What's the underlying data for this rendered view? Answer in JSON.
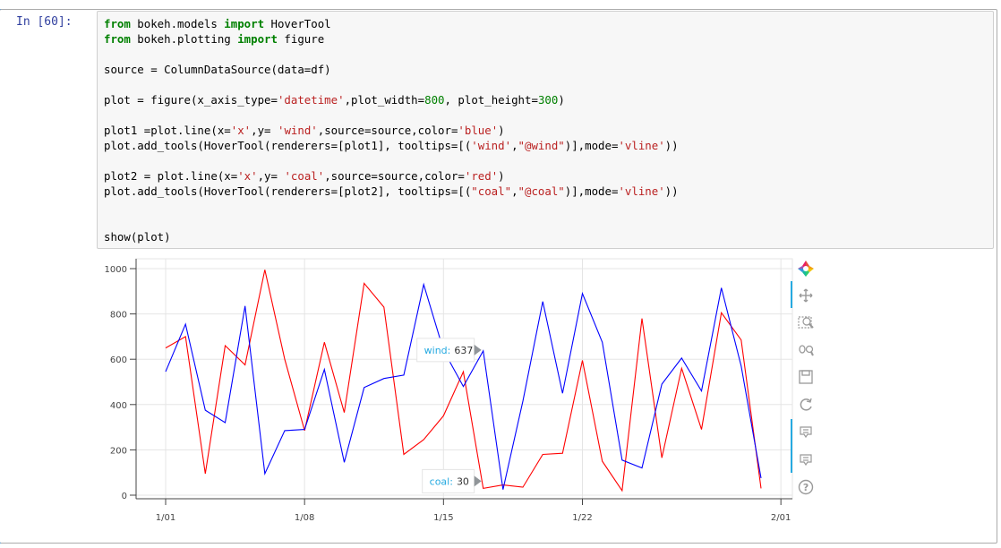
{
  "cell": {
    "prompt": "In [60]:",
    "code_lines": [
      [
        {
          "t": "from",
          "c": "kw"
        },
        {
          "t": " bokeh.models "
        },
        {
          "t": "import",
          "c": "kw"
        },
        {
          "t": " HoverTool"
        }
      ],
      [
        {
          "t": "from",
          "c": "kw"
        },
        {
          "t": " bokeh.plotting "
        },
        {
          "t": "import",
          "c": "kw"
        },
        {
          "t": " figure"
        }
      ],
      [],
      [
        {
          "t": "source = ColumnDataSource(data=df)"
        }
      ],
      [],
      [
        {
          "t": "plot = figure(x_axis_type="
        },
        {
          "t": "'datetime'",
          "c": "str"
        },
        {
          "t": ",plot_width="
        },
        {
          "t": "800",
          "c": "num"
        },
        {
          "t": ", plot_height="
        },
        {
          "t": "300",
          "c": "num"
        },
        {
          "t": ")"
        }
      ],
      [],
      [
        {
          "t": "plot1 =plot.line(x="
        },
        {
          "t": "'x'",
          "c": "str"
        },
        {
          "t": ",y= "
        },
        {
          "t": "'wind'",
          "c": "str"
        },
        {
          "t": ",source=source,color="
        },
        {
          "t": "'blue'",
          "c": "str"
        },
        {
          "t": ")"
        }
      ],
      [
        {
          "t": "plot.add_tools(HoverTool(renderers=[plot1], tooltips=[("
        },
        {
          "t": "'wind'",
          "c": "str"
        },
        {
          "t": ","
        },
        {
          "t": "\"@wind\"",
          "c": "str"
        },
        {
          "t": ")],mode="
        },
        {
          "t": "'vline'",
          "c": "str"
        },
        {
          "t": "))"
        }
      ],
      [],
      [
        {
          "t": "plot2 = plot.line(x="
        },
        {
          "t": "'x'",
          "c": "str"
        },
        {
          "t": ",y= "
        },
        {
          "t": "'coal'",
          "c": "str"
        },
        {
          "t": ",source=source,color="
        },
        {
          "t": "'red'",
          "c": "str"
        },
        {
          "t": ")"
        }
      ],
      [
        {
          "t": "plot.add_tools(HoverTool(renderers=[plot2], tooltips=[("
        },
        {
          "t": "\"coal\"",
          "c": "str"
        },
        {
          "t": ","
        },
        {
          "t": "\"@coal\"",
          "c": "str"
        },
        {
          "t": ")],mode="
        },
        {
          "t": "'vline'",
          "c": "str"
        },
        {
          "t": "))"
        }
      ],
      [],
      [],
      [
        {
          "t": "show(plot)"
        }
      ]
    ]
  },
  "chart_data": {
    "type": "line",
    "x": [
      "2017-01-01",
      "2017-01-02",
      "2017-01-03",
      "2017-01-04",
      "2017-01-05",
      "2017-01-06",
      "2017-01-07",
      "2017-01-08",
      "2017-01-09",
      "2017-01-10",
      "2017-01-11",
      "2017-01-12",
      "2017-01-13",
      "2017-01-14",
      "2017-01-15",
      "2017-01-16",
      "2017-01-17",
      "2017-01-18",
      "2017-01-19",
      "2017-01-20",
      "2017-01-21",
      "2017-01-22",
      "2017-01-23",
      "2017-01-24",
      "2017-01-25",
      "2017-01-26",
      "2017-01-27",
      "2017-01-28",
      "2017-01-29",
      "2017-01-30",
      "2017-01-31"
    ],
    "series": [
      {
        "name": "wind",
        "color": "#0000ff",
        "values": [
          545,
          755,
          375,
          320,
          835,
          95,
          285,
          290,
          555,
          145,
          475,
          515,
          530,
          930,
          640,
          480,
          637,
          25,
          415,
          855,
          450,
          890,
          675,
          155,
          120,
          490,
          605,
          460,
          915,
          570,
          75
        ]
      },
      {
        "name": "coal",
        "color": "#ff0000",
        "values": [
          650,
          700,
          95,
          660,
          575,
          995,
          600,
          285,
          675,
          365,
          935,
          830,
          180,
          245,
          350,
          545,
          30,
          45,
          35,
          180,
          185,
          595,
          150,
          20,
          780,
          165,
          560,
          290,
          805,
          685,
          30
        ]
      }
    ],
    "x_ticks": [
      "1/01",
      "1/08",
      "1/15",
      "1/22",
      "2/01"
    ],
    "y_ticks": [
      0,
      200,
      400,
      600,
      800,
      1000
    ],
    "ylim": [
      -20,
      1020
    ],
    "grid": true,
    "tooltips": [
      {
        "label": "wind:",
        "value": "637"
      },
      {
        "label": "coal:",
        "value": "30"
      }
    ]
  },
  "toolbar": {
    "tools": [
      "bokeh-logo-icon",
      "pan-icon",
      "box-zoom-icon",
      "wheel-zoom-icon",
      "save-icon",
      "reset-icon",
      "hover-wind-icon",
      "hover-coal-icon",
      "help-icon"
    ]
  },
  "colors": {
    "accent": "#42a5f5",
    "prompt": "#303f9f",
    "tooltip_label": "#26aae1"
  }
}
